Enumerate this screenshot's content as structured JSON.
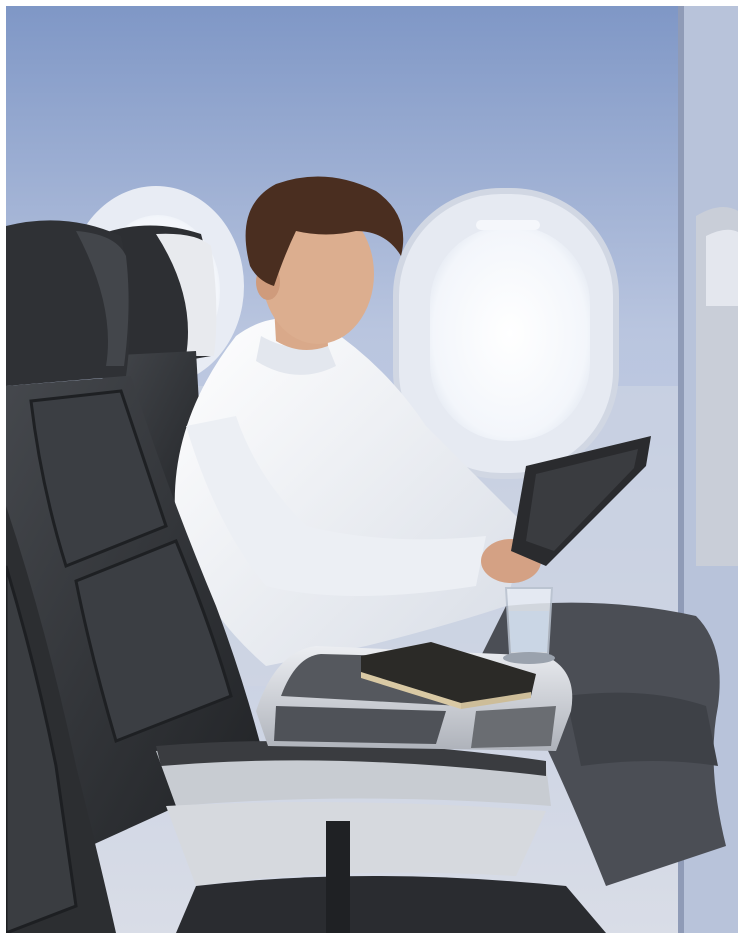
{
  "photo": {
    "subject": "airplane-cabin-passenger-with-tablet",
    "colors": {
      "wall": "#c8d0e3",
      "wall_light": "#e4e8f2",
      "seat_leather": "#2e3033",
      "seat_panel": "#3d4044",
      "seat_trim": "#c9cbd0",
      "shirt": "#f1f3f6",
      "hair": "#4a2e20",
      "skin": "#d9a98a",
      "trousers": "#4b4e55",
      "window_glow": "#ffffff",
      "notebook": "#2b2a27",
      "tablet": "#2a2b2e"
    }
  }
}
